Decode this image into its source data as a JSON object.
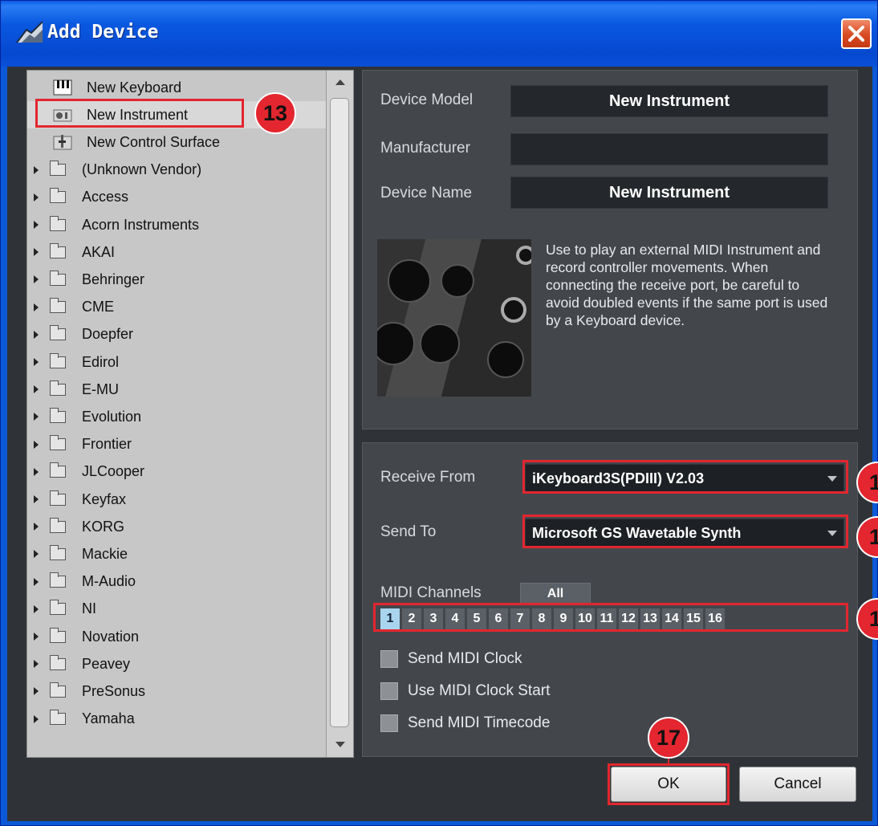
{
  "window": {
    "title": "Add Device"
  },
  "device_list": {
    "items": [
      {
        "label": "New Keyboard",
        "type": "device",
        "icon": "keyboard-icon"
      },
      {
        "label": "New Instrument",
        "type": "device",
        "icon": "instrument-icon",
        "selected": true
      },
      {
        "label": "New Control Surface",
        "type": "device",
        "icon": "control-surface-icon"
      },
      {
        "label": "(Unknown Vendor)",
        "type": "folder"
      },
      {
        "label": "Access",
        "type": "folder"
      },
      {
        "label": "Acorn Instruments",
        "type": "folder"
      },
      {
        "label": "AKAI",
        "type": "folder"
      },
      {
        "label": "Behringer",
        "type": "folder"
      },
      {
        "label": "CME",
        "type": "folder"
      },
      {
        "label": "Doepfer",
        "type": "folder"
      },
      {
        "label": "Edirol",
        "type": "folder"
      },
      {
        "label": "E-MU",
        "type": "folder"
      },
      {
        "label": "Evolution",
        "type": "folder"
      },
      {
        "label": "Frontier",
        "type": "folder"
      },
      {
        "label": "JLCooper",
        "type": "folder"
      },
      {
        "label": "Keyfax",
        "type": "folder"
      },
      {
        "label": "KORG",
        "type": "folder"
      },
      {
        "label": "Mackie",
        "type": "folder"
      },
      {
        "label": "M-Audio",
        "type": "folder"
      },
      {
        "label": "NI",
        "type": "folder"
      },
      {
        "label": "Novation",
        "type": "folder"
      },
      {
        "label": "Peavey",
        "type": "folder"
      },
      {
        "label": "PreSonus",
        "type": "folder"
      },
      {
        "label": "Yamaha",
        "type": "folder"
      }
    ]
  },
  "info": {
    "device_model_label": "Device Model",
    "device_model_value": "New Instrument",
    "manufacturer_label": "Manufacturer",
    "manufacturer_value": "",
    "device_name_label": "Device Name",
    "device_name_value": "New Instrument",
    "description": "Use to play an external MIDI Instrument and record controller movements. When connecting the receive port, be careful to avoid doubled events if the same port is used by a Keyboard device."
  },
  "settings": {
    "receive_from_label": "Receive From",
    "receive_from_value": "iKeyboard3S(PDIII) V2.03",
    "send_to_label": "Send To",
    "send_to_value": "Microsoft GS Wavetable Synth",
    "midi_channels_label": "MIDI Channels",
    "all_label": "All",
    "channels": [
      "1",
      "2",
      "3",
      "4",
      "5",
      "6",
      "7",
      "8",
      "9",
      "10",
      "11",
      "12",
      "13",
      "14",
      "15",
      "16"
    ],
    "active_channel": 1,
    "send_midi_clock": "Send MIDI Clock",
    "use_midi_clock_start": "Use MIDI Clock Start",
    "send_midi_timecode": "Send MIDI Timecode"
  },
  "buttons": {
    "ok": "OK",
    "cancel": "Cancel"
  },
  "annotations": {
    "badge_13": "13",
    "badge_14": "1",
    "badge_15": "1",
    "badge_16": "1",
    "badge_17": "17"
  },
  "colors": {
    "highlight": "#e3262f",
    "panel": "#43474c",
    "titlebar": "#0a58e0"
  }
}
